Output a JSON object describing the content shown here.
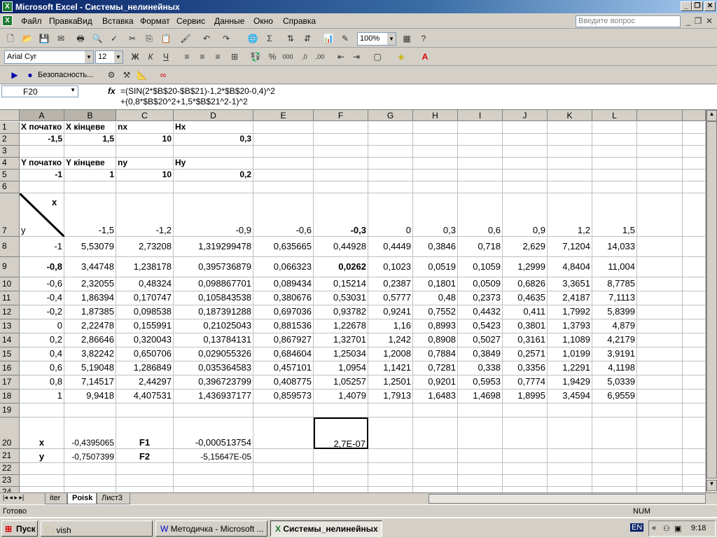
{
  "window": {
    "title": "Microsoft Excel - Системы_нелинейных",
    "app_icon": "excel-icon"
  },
  "menu": [
    "Файл",
    "Правка",
    "Вид",
    "Вставка",
    "Формат",
    "Сервис",
    "Данные",
    "Окно",
    "Справка"
  ],
  "ask_placeholder": "Введите вопрос",
  "toolbar": {
    "zoom": "100%",
    "font": "Arial Cyr",
    "size": "12",
    "security": "Безопасность..."
  },
  "namebox": "F20",
  "formula": "=(SIN(2*$B$20-$B$21)-1,2*$B$20-0,4)^2\n+(0,8*$B$20^2+1,5*$B$21^2-1)^2",
  "columns": [
    "A",
    "B",
    "C",
    "D",
    "E",
    "F",
    "G",
    "H",
    "I",
    "J",
    "K",
    "L"
  ],
  "rows": [
    {
      "n": "1",
      "cells": [
        "X початко",
        "X кінцеве",
        "nx",
        "Hx",
        "",
        "",
        "",
        "",
        "",
        "",
        "",
        ""
      ]
    },
    {
      "n": "2",
      "cells": [
        "-1,5",
        "1,5",
        "10",
        "0,3",
        "",
        "",
        "",
        "",
        "",
        "",
        "",
        ""
      ]
    },
    {
      "n": "3",
      "cells": [
        "",
        "",
        "",
        "",
        "",
        "",
        "",
        "",
        "",
        "",
        "",
        ""
      ]
    },
    {
      "n": "4",
      "cells": [
        "Y початко",
        "Y кінцеве",
        "ny",
        "Hy",
        "",
        "",
        "",
        "",
        "",
        "",
        "",
        ""
      ]
    },
    {
      "n": "5",
      "cells": [
        "-1",
        "1",
        "10",
        "0,2",
        "",
        "",
        "",
        "",
        "",
        "",
        "",
        ""
      ]
    },
    {
      "n": "6",
      "cells": [
        "",
        "",
        "",
        "",
        "",
        "",
        "",
        "",
        "",
        "",
        "",
        ""
      ]
    },
    {
      "n": "7",
      "cells": [
        "y",
        "-1,5",
        "-1,2",
        "-0,9",
        "-0,6",
        "-0,3",
        "0",
        "0,3",
        "0,6",
        "0,9",
        "1,2",
        "1,5"
      ]
    },
    {
      "n": "8",
      "cells": [
        "-1",
        "5,53079",
        "2,73208",
        "1,319299478",
        "0,635665",
        "0,44928",
        "0,4449",
        "0,3846",
        "0,718",
        "2,629",
        "7,1204",
        "14,033"
      ]
    },
    {
      "n": "9",
      "cells": [
        "-0,8",
        "3,44748",
        "1,238178",
        "0,395736879",
        "0,066323",
        "0,0262",
        "0,1023",
        "0,0519",
        "0,1059",
        "1,2999",
        "4,8404",
        "11,004"
      ]
    },
    {
      "n": "10",
      "cells": [
        "-0,6",
        "2,32055",
        "0,48324",
        "0,098867701",
        "0,089434",
        "0,15214",
        "0,2387",
        "0,1801",
        "0,0509",
        "0,6826",
        "3,3651",
        "8,7785"
      ]
    },
    {
      "n": "11",
      "cells": [
        "-0,4",
        "1,86394",
        "0,170747",
        "0,105843538",
        "0,380676",
        "0,53031",
        "0,5777",
        "0,48",
        "0,2373",
        "0,4635",
        "2,4187",
        "7,1113"
      ]
    },
    {
      "n": "12",
      "cells": [
        "-0,2",
        "1,87385",
        "0,098538",
        "0,187391288",
        "0,697036",
        "0,93782",
        "0,9241",
        "0,7552",
        "0,4432",
        "0,411",
        "1,7992",
        "5,8399"
      ]
    },
    {
      "n": "13",
      "cells": [
        "0",
        "2,22478",
        "0,155991",
        "0,21025043",
        "0,881536",
        "1,22678",
        "1,16",
        "0,8993",
        "0,5423",
        "0,3801",
        "1,3793",
        "4,879"
      ]
    },
    {
      "n": "14",
      "cells": [
        "0,2",
        "2,86646",
        "0,320043",
        "0,13784131",
        "0,867927",
        "1,32701",
        "1,242",
        "0,8908",
        "0,5027",
        "0,3161",
        "1,1089",
        "4,2179"
      ]
    },
    {
      "n": "15",
      "cells": [
        "0,4",
        "3,82242",
        "0,650706",
        "0,029055326",
        "0,684604",
        "1,25034",
        "1,2008",
        "0,7884",
        "0,3849",
        "0,2571",
        "1,0199",
        "3,9191"
      ]
    },
    {
      "n": "16",
      "cells": [
        "0,6",
        "5,19048",
        "1,286849",
        "0,035364583",
        "0,457101",
        "1,0954",
        "1,1421",
        "0,7281",
        "0,338",
        "0,3356",
        "1,2291",
        "4,1198"
      ]
    },
    {
      "n": "17",
      "cells": [
        "0,8",
        "7,14517",
        "2,44297",
        "0,396723799",
        "0,408775",
        "1,05257",
        "1,2501",
        "0,9201",
        "0,5953",
        "0,7774",
        "1,9429",
        "5,0339"
      ]
    },
    {
      "n": "18",
      "cells": [
        "1",
        "9,9418",
        "4,407531",
        "1,436937177",
        "0,859573",
        "1,4079",
        "1,7913",
        "1,6483",
        "1,4698",
        "1,8995",
        "3,4594",
        "6,9559"
      ]
    },
    {
      "n": "19",
      "cells": [
        "",
        "",
        "",
        "",
        "",
        "",
        "",
        "",
        "",
        "",
        "",
        ""
      ]
    },
    {
      "n": "20",
      "cells": [
        "x",
        "-0,4395065",
        "F1",
        "-0,000513754",
        "",
        "2,7E-07",
        "",
        "",
        "",
        "",
        "",
        ""
      ]
    },
    {
      "n": "21",
      "cells": [
        "y",
        "-0,7507399",
        "F2",
        "-5,15647E-05",
        "",
        "",
        "",
        "",
        "",
        "",
        "",
        ""
      ]
    },
    {
      "n": "22",
      "cells": [
        "",
        "",
        "",
        "",
        "",
        "",
        "",
        "",
        "",
        "",
        "",
        ""
      ]
    },
    {
      "n": "23",
      "cells": [
        "",
        "",
        "",
        "",
        "",
        "",
        "",
        "",
        "",
        "",
        "",
        ""
      ]
    },
    {
      "n": "24",
      "cells": [
        "",
        "",
        "",
        "",
        "",
        "",
        "",
        "",
        "",
        "",
        "",
        ""
      ]
    },
    {
      "n": "25",
      "cells": [
        "",
        "",
        "",
        "",
        "",
        "",
        "",
        "",
        "",
        "",
        "",
        ""
      ]
    }
  ],
  "diag_x_label": "x",
  "sheets": [
    "iter",
    "Poisk",
    "Лист3"
  ],
  "status": {
    "left": "Готово",
    "num": "NUM"
  },
  "taskbar": {
    "start": "Пуск",
    "items": [
      "vish",
      "Методичка - Microsoft ...",
      "Системы_нелинейных"
    ],
    "lang": "EN",
    "time": "9:18"
  }
}
